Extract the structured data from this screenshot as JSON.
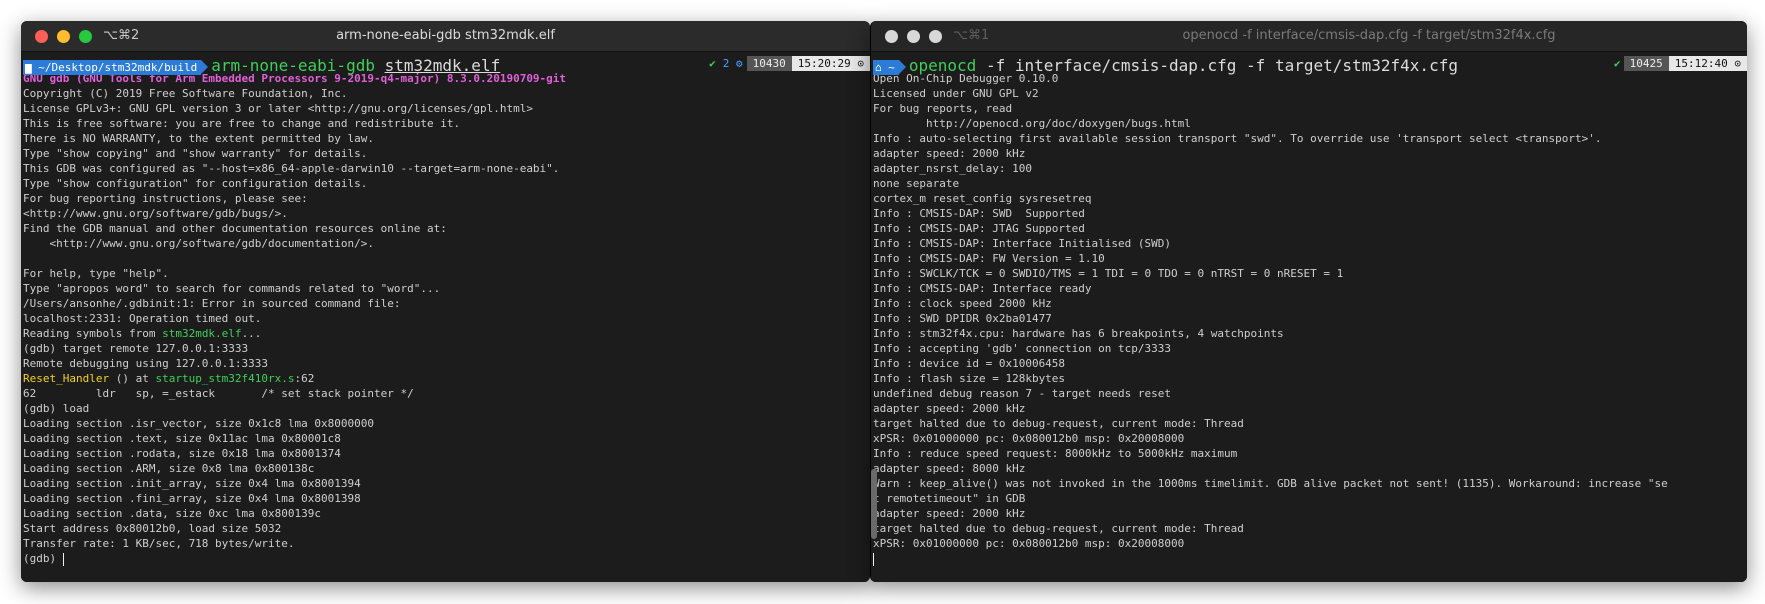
{
  "left_window": {
    "shortcut": "⌥⌘2",
    "title": "arm-none-eabi-gdb stm32mdk.elf",
    "prompt": {
      "path": "~/Desktop/stm32mdk/build",
      "command": "arm-none-eabi-gdb",
      "arg": "stm32mdk.elf",
      "status_check": "✔",
      "jobs": "2 ⚙",
      "history": "10430",
      "time": "15:20:29 ⊙"
    },
    "lines": [
      {
        "text": "GNU gdb (GNU Tools for Arm Embedded Processors 9-2019-q4-major) 8.3.0.20190709-git",
        "style": "banner"
      },
      {
        "text": "Copyright (C) 2019 Free Software Foundation, Inc."
      },
      {
        "text": "License GPLv3+: GNU GPL version 3 or later <http://gnu.org/licenses/gpl.html>"
      },
      {
        "text": "This is free software: you are free to change and redistribute it."
      },
      {
        "text": "There is NO WARRANTY, to the extent permitted by law."
      },
      {
        "text": "Type \"show copying\" and \"show warranty\" for details."
      },
      {
        "text": "This GDB was configured as \"--host=x86_64-apple-darwin10 --target=arm-none-eabi\"."
      },
      {
        "text": "Type \"show configuration\" for configuration details."
      },
      {
        "text": "For bug reporting instructions, please see:"
      },
      {
        "text": "<http://www.gnu.org/software/gdb/bugs/>."
      },
      {
        "text": "Find the GDB manual and other documentation resources online at:"
      },
      {
        "text": "    <http://www.gnu.org/software/gdb/documentation/>."
      },
      {
        "text": ""
      },
      {
        "text": "For help, type \"help\"."
      },
      {
        "text": "Type \"apropos word\" to search for commands related to \"word\"..."
      },
      {
        "text": "/Users/ansonhe/.gdbinit:1: Error in sourced command file:"
      },
      {
        "text": "localhost:2331: Operation timed out."
      },
      {
        "pre": "Reading symbols from ",
        "hl": "stm32mdk.elf",
        "post": "...",
        "hlstyle": "green"
      },
      {
        "text": "(gdb) target remote 127.0.0.1:3333"
      },
      {
        "text": "Remote debugging using 127.0.0.1:3333"
      },
      {
        "pre": "",
        "hl": "Reset_Handler",
        "post": " () at ",
        "hl2": "startup_stm32f410rx.s",
        "post2": ":62",
        "hlstyle": "yellow"
      },
      {
        "text": "62\t   ldr   sp, =_estack       /* set stack pointer */"
      },
      {
        "text": "(gdb) load"
      },
      {
        "text": "Loading section .isr_vector, size 0x1c8 lma 0x8000000"
      },
      {
        "text": "Loading section .text, size 0x11ac lma 0x80001c8"
      },
      {
        "text": "Loading section .rodata, size 0x18 lma 0x8001374"
      },
      {
        "text": "Loading section .ARM, size 0x8 lma 0x800138c"
      },
      {
        "text": "Loading section .init_array, size 0x4 lma 0x8001394"
      },
      {
        "text": "Loading section .fini_array, size 0x4 lma 0x8001398"
      },
      {
        "text": "Loading section .data, size 0xc lma 0x800139c"
      },
      {
        "text": "Start address 0x80012b0, load size 5032"
      },
      {
        "text": "Transfer rate: 1 KB/sec, 718 bytes/write."
      },
      {
        "text": "(gdb) "
      }
    ]
  },
  "right_window": {
    "shortcut": "⌥⌘1",
    "title": "openocd -f interface/cmsis-dap.cfg -f target/stm32f4x.cfg",
    "prompt": {
      "path": "~",
      "command": "openocd",
      "arg": "-f interface/cmsis-dap.cfg -f target/stm32f4x.cfg",
      "status_check": "✔",
      "history": "10425",
      "time": "15:12:40 ⊙"
    },
    "lines": [
      "Open On-Chip Debugger 0.10.0",
      "Licensed under GNU GPL v2",
      "For bug reports, read",
      "        http://openocd.org/doc/doxygen/bugs.html",
      "Info : auto-selecting first available session transport \"swd\". To override use 'transport select <transport>'.",
      "adapter speed: 2000 kHz",
      "adapter_nsrst_delay: 100",
      "none separate",
      "cortex_m reset_config sysresetreq",
      "Info : CMSIS-DAP: SWD  Supported",
      "Info : CMSIS-DAP: JTAG Supported",
      "Info : CMSIS-DAP: Interface Initialised (SWD)",
      "Info : CMSIS-DAP: FW Version = 1.10",
      "Info : SWCLK/TCK = 0 SWDIO/TMS = 1 TDI = 0 TDO = 0 nTRST = 0 nRESET = 1",
      "Info : CMSIS-DAP: Interface ready",
      "Info : clock speed 2000 kHz",
      "Info : SWD DPIDR 0x2ba01477",
      "Info : stm32f4x.cpu: hardware has 6 breakpoints, 4 watchpoints",
      "Info : accepting 'gdb' connection on tcp/3333",
      "Info : device id = 0x10006458",
      "Info : flash size = 128kbytes",
      "undefined debug reason 7 - target needs reset",
      "adapter speed: 2000 kHz",
      "target halted due to debug-request, current mode: Thread",
      "xPSR: 0x01000000 pc: 0x080012b0 msp: 0x20008000",
      "Info : reduce speed request: 8000kHz to 5000kHz maximum",
      "adapter speed: 8000 kHz",
      "Warn : keep_alive() was not invoked in the 1000ms timelimit. GDB alive packet not sent! (1135). Workaround: increase \"se",
      "t remotetimeout\" in GDB",
      "adapter speed: 2000 kHz",
      "target halted due to debug-request, current mode: Thread",
      "xPSR: 0x01000000 pc: 0x080012b0 msp: 0x20008000"
    ]
  }
}
